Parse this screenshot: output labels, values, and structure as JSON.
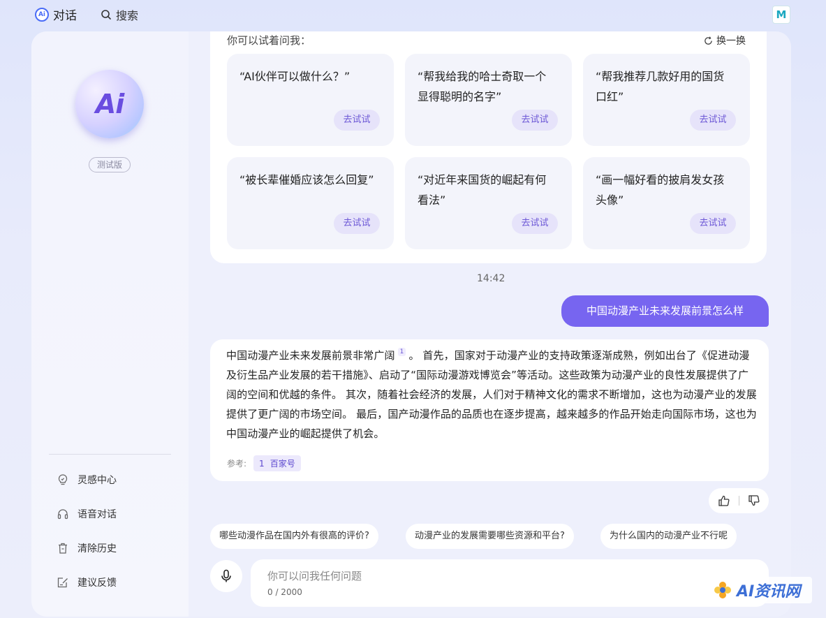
{
  "header": {
    "chat_tab": "对话",
    "search_tab": "搜索",
    "chat_logo_text": "Ai",
    "user_avatar_text": "M"
  },
  "sidebar": {
    "logo_text": "Ai",
    "beta_badge": "测试版",
    "items": [
      {
        "label": "灵感中心",
        "icon": "lightbulb-icon"
      },
      {
        "label": "语音对话",
        "icon": "headphones-icon"
      },
      {
        "label": "清除历史",
        "icon": "trash-icon"
      },
      {
        "label": "建议反馈",
        "icon": "feedback-icon"
      }
    ]
  },
  "prompts": {
    "title": "你可以试着问我：",
    "refresh_label": "换一换",
    "try_label": "去试试",
    "cards": [
      {
        "text": "“AI伙伴可以做什么？”"
      },
      {
        "text": "“帮我给我的哈士奇取一个显得聪明的名字”"
      },
      {
        "text": "“帮我推荐几款好用的国货口红”"
      },
      {
        "text": "“被长辈催婚应该怎么回复”"
      },
      {
        "text": "“对近年来国货的崛起有何看法”"
      },
      {
        "text": "“画一幅好看的披肩发女孩头像”"
      }
    ]
  },
  "conversation": {
    "timestamp": "14:42",
    "user_message": "中国动漫产业未来发展前景怎么样",
    "answer_part1": "中国动漫产业未来发展前景非常广阔",
    "citation_number": "1",
    "answer_part2": "。 首先，国家对于动漫产业的支持政策逐渐成熟，例如出台了《促进动漫及衍生品产业发展的若干措施》、启动了“国际动漫游戏博览会”等活动。这些政策为动漫产业的良性发展提供了广阔的空间和优越的条件。 其次，随着社会经济的发展，人们对于精神文化的需求不断增加，这也为动漫产业的发展提供了更广阔的市场空间。 最后，国产动漫作品的品质也在逐步提高，越来越多的作品开始走向国际市场，这也为中国动漫产业的崛起提供了机会。",
    "reference_label": "参考:",
    "reference_number": "1",
    "reference_source": "百家号"
  },
  "suggestions": [
    "哪些动漫作品在国内外有很高的评价?",
    "动漫产业的发展需要哪些资源和平台?",
    "为什么国内的动漫产业不行呢"
  ],
  "input": {
    "placeholder": "你可以问我任何问题",
    "value": "",
    "counter": "0 / 2000"
  },
  "watermark": {
    "text": "AI资讯网"
  },
  "colors": {
    "accent": "#7765f0",
    "accent_light": "#e6e3fa",
    "background": "#e8ebfb"
  }
}
